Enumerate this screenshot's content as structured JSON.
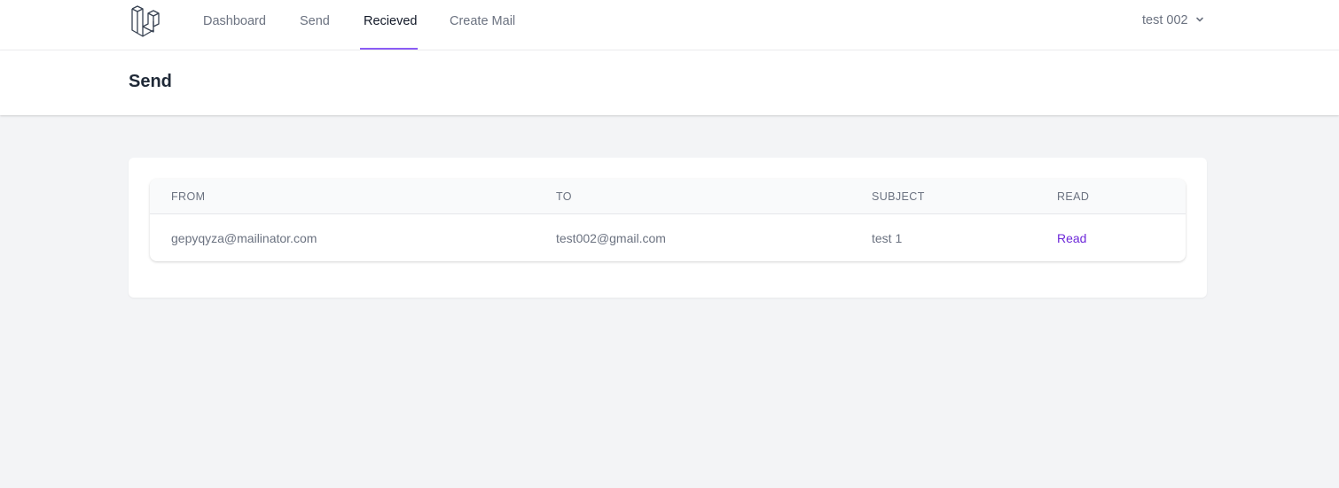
{
  "nav": {
    "items": [
      {
        "label": "Dashboard"
      },
      {
        "label": "Send"
      },
      {
        "label": "Recieved"
      },
      {
        "label": "Create Mail"
      }
    ],
    "active": "Recieved",
    "user": "test 002"
  },
  "header": {
    "title": "Send"
  },
  "table": {
    "columns": [
      "FROM",
      "TO",
      "SUBJECT",
      "READ"
    ],
    "rows": [
      {
        "from": "gepyqyza@mailinator.com",
        "to": "test002@gmail.com",
        "subject": "test 1",
        "read": "Read"
      }
    ]
  },
  "colors": {
    "accent": "#8b5cf6",
    "link": "#6d28d9",
    "background": "#f3f4f6"
  }
}
